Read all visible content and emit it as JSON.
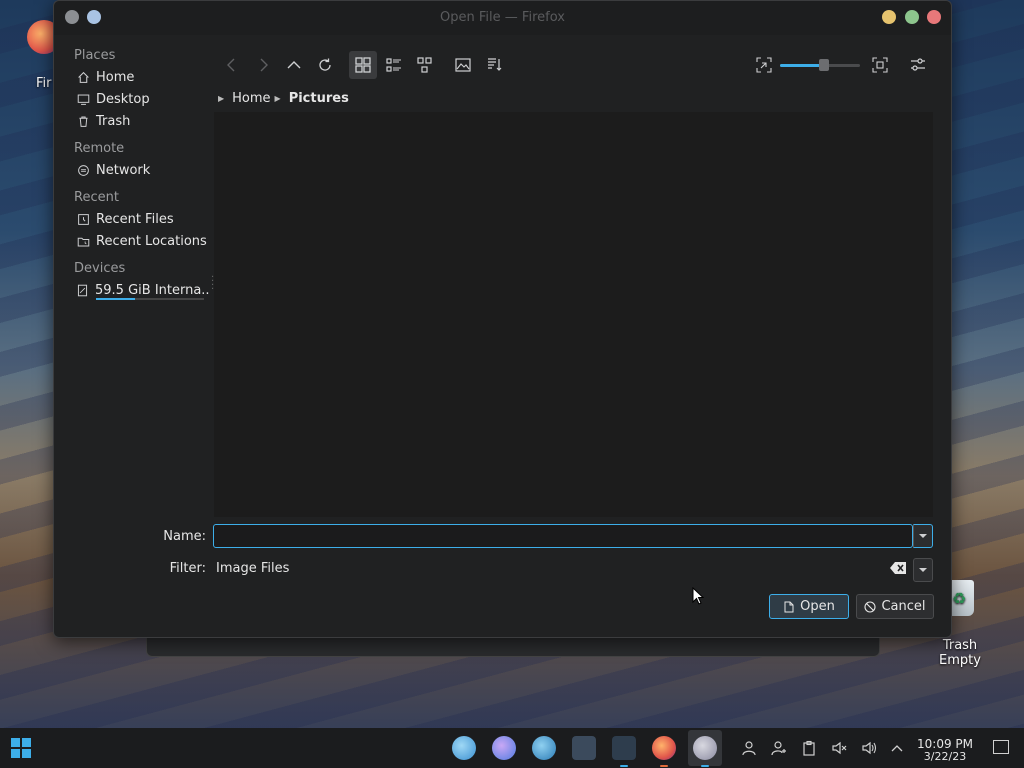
{
  "window": {
    "title": "Open File — Firefox"
  },
  "sidebar": {
    "sections": [
      {
        "heading": "Places",
        "items": [
          {
            "label": "Home",
            "icon": "home-icon"
          },
          {
            "label": "Desktop",
            "icon": "desktop-icon"
          },
          {
            "label": "Trash",
            "icon": "trash-icon"
          }
        ]
      },
      {
        "heading": "Remote",
        "items": [
          {
            "label": "Network",
            "icon": "network-icon"
          }
        ]
      },
      {
        "heading": "Recent",
        "items": [
          {
            "label": "Recent Files",
            "icon": "recent-files-icon"
          },
          {
            "label": "Recent Locations",
            "icon": "recent-locations-icon"
          }
        ]
      },
      {
        "heading": "Devices",
        "items": [
          {
            "label": "59.5 GiB Interna...",
            "icon": "drive-icon",
            "usage_fraction": 0.36
          }
        ]
      }
    ]
  },
  "toolbar": {
    "buttons": [
      "back-icon",
      "forward-icon",
      "up-icon",
      "reload-icon",
      "icon-view-icon",
      "compact-view-icon",
      "tree-view-icon",
      "preview-icon",
      "sort-icon"
    ],
    "zoom_level": 0.55
  },
  "breadcrumb": [
    "Home",
    "Pictures"
  ],
  "form": {
    "name_label": "Name:",
    "name_value": "",
    "filter_label": "Filter:",
    "filter_value": "Image Files"
  },
  "buttons": {
    "open": "Open",
    "cancel": "Cancel"
  },
  "desktop": {
    "firefox_label": "Fir",
    "trash_label": "Trash",
    "trash_status": "Empty"
  },
  "taskbar": {
    "time": "10:09 PM",
    "date": "3/22/23"
  },
  "colors": {
    "accent": "#3daee9",
    "dialog_bg": "#202122",
    "view_bg": "#1c1c1c"
  }
}
